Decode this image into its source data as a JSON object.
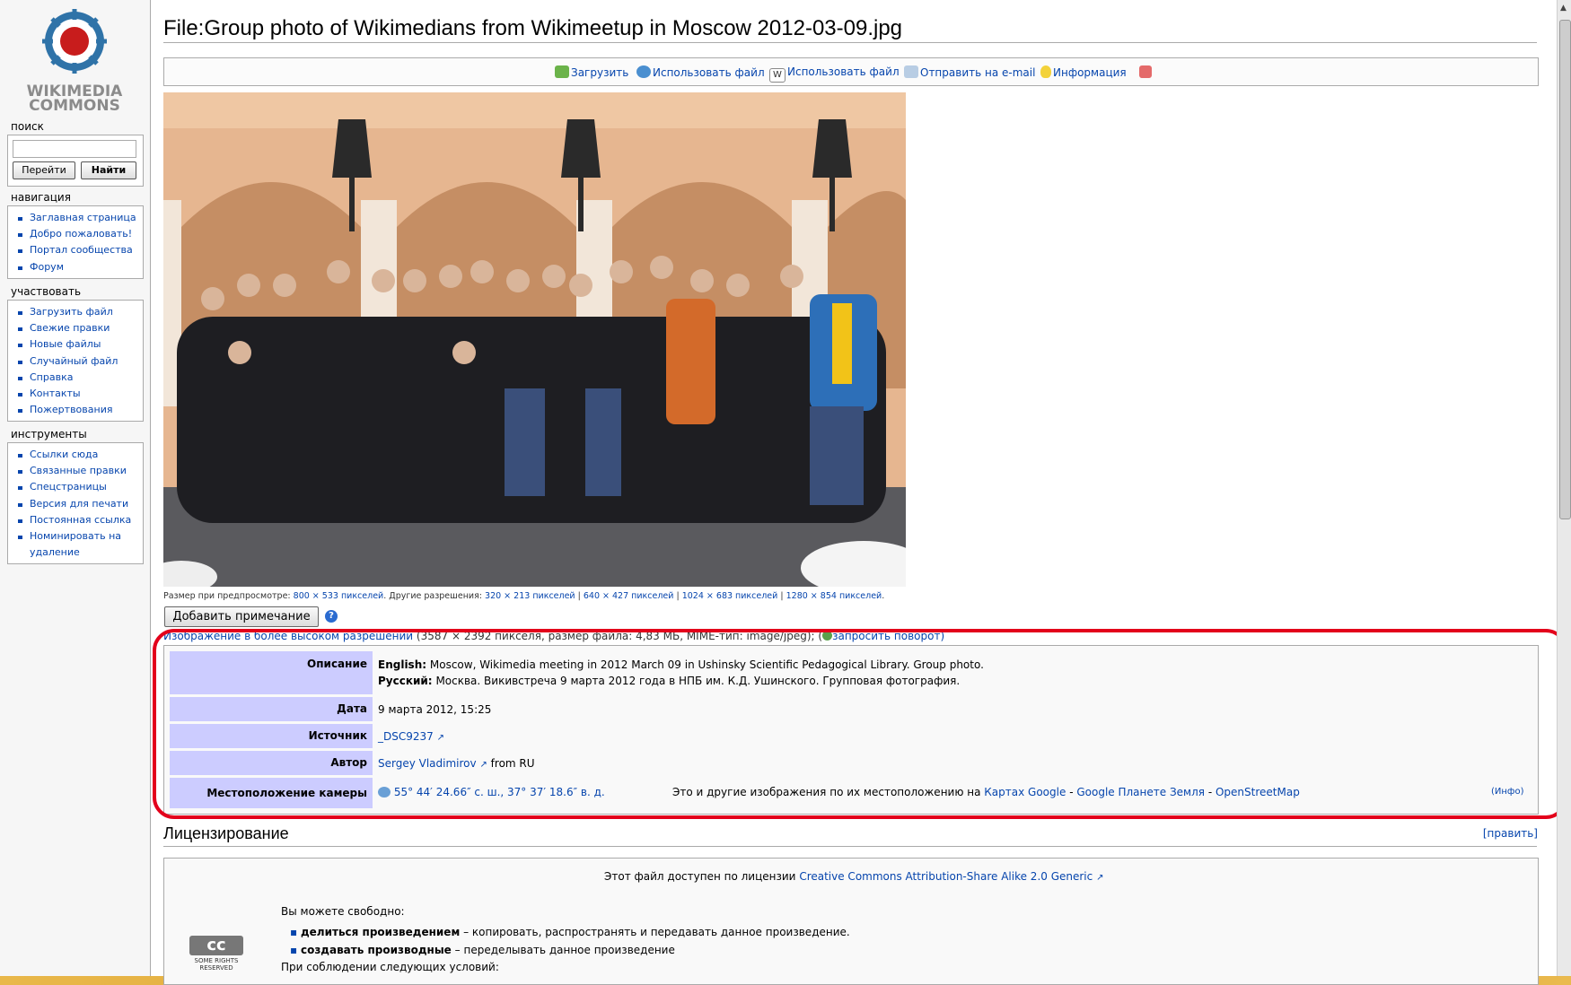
{
  "logo": {
    "line1": "WIKIMEDIA",
    "line2": "COMMONS"
  },
  "sidebar": {
    "search_heading": "поиск",
    "go_button": "Перейти",
    "search_button": "Найти",
    "nav_heading": "навигация",
    "nav": [
      "Заглавная страница",
      "Добро пожаловать!",
      "Портал сообщества",
      "Форум"
    ],
    "participate_heading": "участвовать",
    "participate": [
      "Загрузить файл",
      "Свежие правки",
      "Новые файлы",
      "Случайный файл",
      "Справка",
      "Контакты",
      "Пожертвования"
    ],
    "tools_heading": "инструменты",
    "tools": [
      "Ссылки сюда",
      "Связанные правки",
      "Спецстраницы",
      "Версия для печати",
      "Постоянная ссылка",
      "Номинировать на",
      "удаление"
    ]
  },
  "page": {
    "title": "File:Group photo of Wikimedians from Wikimeetup in Moscow 2012-03-09.jpg"
  },
  "toolbar": {
    "upload": "Загрузить",
    "use_file_1": "Использовать файл",
    "use_file_2": "Использовать файл",
    "email": "Отправить на e-mail",
    "info": "Информация"
  },
  "preview": {
    "label": "Размер при предпросмотре:",
    "size": "800 × 533 пикселей",
    "other_label": ". Другие разрешения:",
    "r1": "320 × 213 пикселей",
    "r2": "640 × 427 пикселей",
    "r3": "1024 × 683 пикселей",
    "r4": "1280 × 854 пикселей",
    "sep": "|",
    "dot": "."
  },
  "add_note": "Добавить примечание",
  "help_mark": "?",
  "hires": {
    "link": "Изображение в более высоком разрешении",
    "details": "(3587 × 2392 пикселя, размер файла: 4,83 МБ, MIME-тип: image/jpeg);",
    "open_paren": "(",
    "rotate": "запросить поворот)"
  },
  "info": {
    "desc_label": "Описание",
    "desc_en_lang": "English:",
    "desc_en": "Moscow, Wikimedia meeting in 2012 March 09 in Ushinsky Scientific Pedagogical Library. Group photo.",
    "desc_ru_lang": "Русский:",
    "desc_ru": "Москва. Викивстреча 9 марта 2012 года в НПБ им. К.Д. Ушинского. Групповая фотография.",
    "date_label": "Дата",
    "date": "9 марта 2012, 15:25",
    "source_label": "Источник",
    "source": "_DSC9237",
    "author_label": "Автор",
    "author": "Sergey Vladimirov",
    "author_from": "from RU",
    "loc_label": "Местоположение камеры",
    "coords": "55° 44′ 24.66″ с. ш., 37° 37′ 18.6″ в. д.",
    "maps_text": "Это и другие изображения по их местоположению на",
    "map1": "Картах Google",
    "map2": "Google Планете Земля",
    "map3": "OpenStreetMap",
    "dash": "-",
    "info_link": "(Инфо)"
  },
  "license": {
    "heading": "Лицензирование",
    "edit": "[править]",
    "intro": "Этот файл доступен по лицензии",
    "link": "Creative Commons Attribution-Share Alike 2.0 Generic",
    "free": "Вы можете свободно:",
    "share_b": "делиться произведением",
    "share": "– копировать, распространять и передавать данное произведение.",
    "remix_b": "создавать производные",
    "remix": "– переделывать данное произведение",
    "cond": "При соблюдении следующих условий:",
    "cc_badge": "cc",
    "cc_small": "SOME RIGHTS RESERVED"
  },
  "colors": {
    "link": "#0645ad",
    "table_header": "#ccccff",
    "highlight": "#e3001b"
  }
}
